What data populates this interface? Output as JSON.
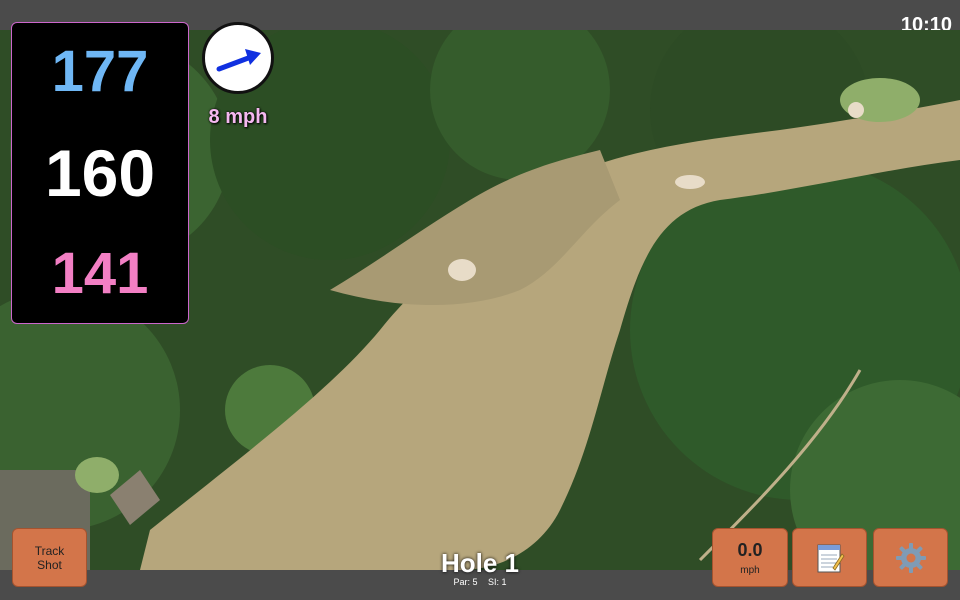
{
  "status": {
    "time": "10:10"
  },
  "distances": {
    "back": "177",
    "middle": "160",
    "front": "141"
  },
  "wind": {
    "speed": "8 mph",
    "direction": "east-north-east",
    "icon": "arrow-icon"
  },
  "hole": {
    "title": "Hole 1",
    "par": "Par: 5",
    "si": "SI: 1"
  },
  "buttons": {
    "track_line1": "Track",
    "track_line2": "Shot",
    "speed_value": "0.0",
    "speed_unit": "mph",
    "notes_icon": "notepad-icon",
    "settings_icon": "gear-icon"
  },
  "colors": {
    "back_distance": "#6fb7f5",
    "middle_distance": "#ffffff",
    "front_distance": "#f27fc4",
    "button_bg": "#d3754a",
    "wind_label": "#f5b8f0"
  }
}
